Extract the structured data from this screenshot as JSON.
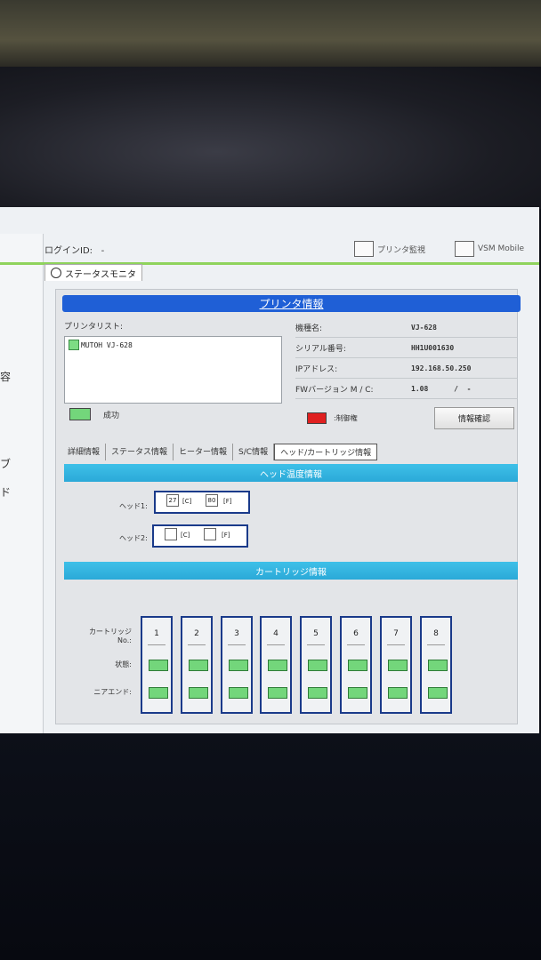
{
  "header": {
    "login_label": "ログインID:",
    "login_value": "-",
    "printer_monitor_label": "プリンタ監視",
    "vsm_label": "VSM Mobile",
    "status_tab_label": "ステータスモニタ"
  },
  "left_strip": [
    "容",
    "ブ",
    "ド"
  ],
  "printer_info": {
    "title": "プリンタ情報",
    "list_label": "プリンタリスト:",
    "list_items": [
      "MUTOH VJ-628"
    ],
    "legend_success": "成功",
    "fields": [
      {
        "key": "機種名:",
        "value": "VJ-628"
      },
      {
        "key": "シリアル番号:",
        "value": "HH1U001630"
      },
      {
        "key": "IPアドレス:",
        "value": "192.168.50.250"
      },
      {
        "key": "FWバージョン M / C:",
        "value": "1.08      /  -"
      }
    ],
    "legend_control": ":制御権",
    "info_button": "情報確認"
  },
  "tabs": [
    "詳細情報",
    "ステータス情報",
    "ヒーター情報",
    "S/C情報",
    "ヘッド/カートリッジ情報"
  ],
  "head_temp": {
    "title": "ヘッド温度情報",
    "heads": [
      {
        "label": "ヘッド1:",
        "c": "27",
        "f": "80"
      },
      {
        "label": "ヘッド2:",
        "c": "",
        "f": ""
      }
    ],
    "unit_c": "[C]",
    "unit_f": "[F]"
  },
  "cartridge": {
    "title": "カートリッジ情報",
    "no_label": "カートリッジNo.:",
    "state_label": "状態:",
    "ic_label": "ニアエンド:",
    "numbers": [
      "1",
      "2",
      "3",
      "4",
      "5",
      "6",
      "7",
      "8"
    ]
  },
  "colors": {
    "title_bar": "#1f5fd6",
    "section_bar": "#2ba9d8",
    "status_green": "#73d67b",
    "control_red": "#e02020"
  }
}
